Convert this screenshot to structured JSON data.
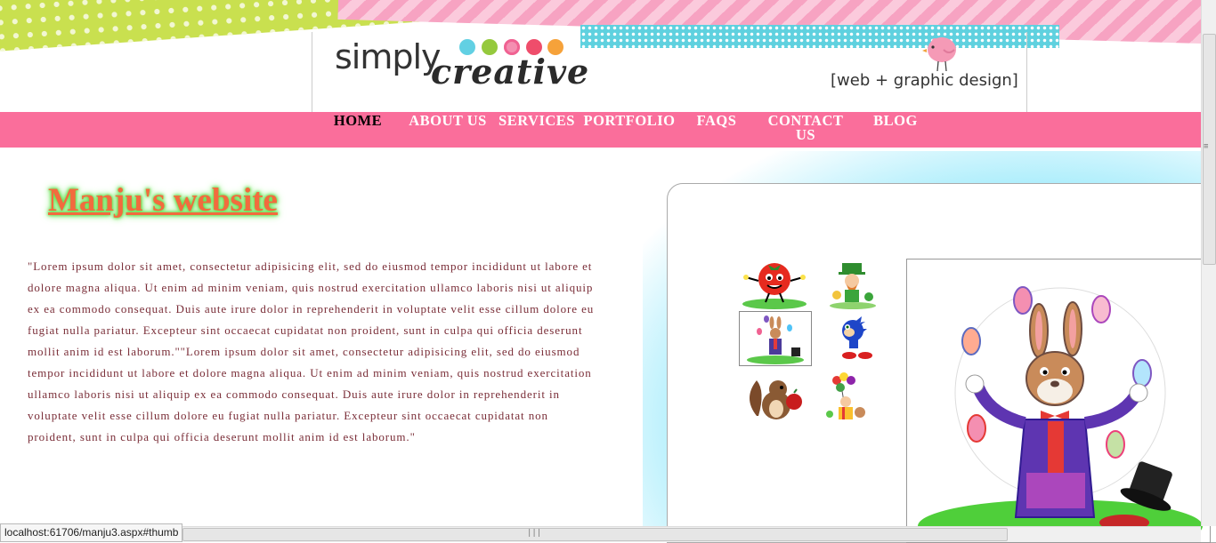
{
  "header": {
    "logo_word_1": "simply",
    "logo_word_2": "creative",
    "tagline": "[web + graphic design]",
    "dot_colors": [
      "#62d0e3",
      "#95c93d",
      "#f48fb1",
      "#ef4d6b",
      "#f6a23a"
    ]
  },
  "nav": {
    "items": [
      {
        "label": "HOME",
        "active": true
      },
      {
        "label": "ABOUT US"
      },
      {
        "label": "SERVICES"
      },
      {
        "label": "PORTFOLIO"
      },
      {
        "label": "FAQS"
      },
      {
        "label": "CONTACT US"
      },
      {
        "label": "BLOG"
      }
    ],
    "bg_color": "#fa6e9b"
  },
  "main": {
    "title": "Manju's website",
    "body": "\"Lorem ipsum dolor sit amet, consectetur adipisicing elit, sed do eiusmod tempor incididunt ut labore et dolore magna aliqua. Ut enim ad minim veniam, quis nostrud exercitation ullamco laboris nisi ut aliquip ex ea commodo consequat. Duis aute irure dolor in reprehenderit in voluptate velit esse cillum dolore eu fugiat nulla pariatur. Excepteur sint occaecat cupidatat non proident, sunt in culpa qui officia deserunt mollit anim id est laborum.\"\"Lorem ipsum dolor sit amet, consectetur adipisicing elit, sed do eiusmod tempor incididunt ut labore et dolore magna aliqua. Ut enim ad minim veniam, quis nostrud exercitation ullamco laboris nisi ut aliquip ex ea commodo consequat. Duis aute irure dolor in reprehenderit in voluptate velit esse cillum dolore eu fugiat nulla pariatur. Excepteur sint occaecat cupidatat non proident, sunt in culpa qui officia deserunt mollit anim id est laborum.\""
  },
  "gallery": {
    "thumbnails": [
      "tomato-cartoon",
      "leprechaun-cartoon",
      "juggling-bunny-cartoon",
      "sonic-cartoon",
      "chipmunk-cartoon",
      "clown-balloons-cartoon"
    ],
    "selected": "juggling-bunny-cartoon",
    "large_image": "juggling-bunny-cartoon"
  },
  "status_bar": {
    "url": "localhost:61706/manju3.aspx#thumb"
  }
}
